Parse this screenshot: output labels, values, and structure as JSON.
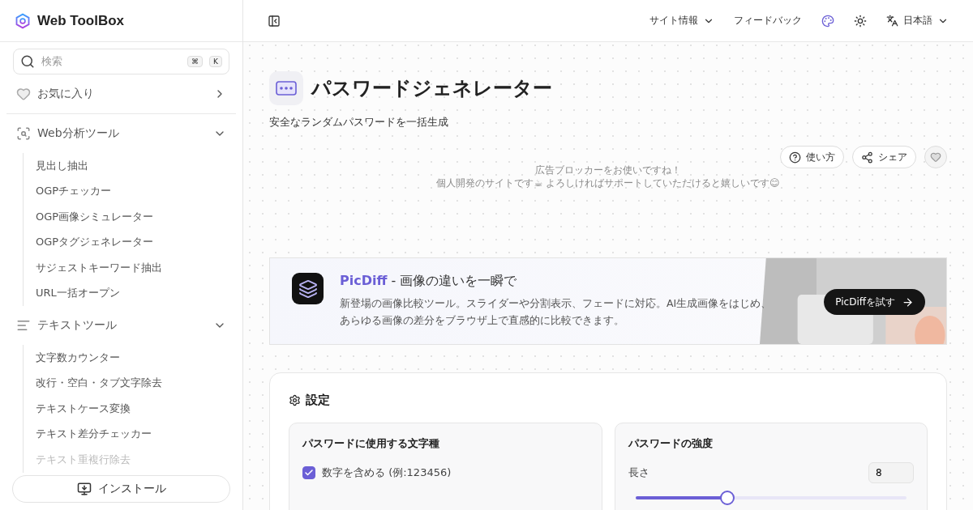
{
  "brand": {
    "name": "Web ToolBox"
  },
  "search": {
    "placeholder": "検索",
    "keys": [
      "⌘",
      "K"
    ]
  },
  "favorites": {
    "label": "お気に入り",
    "expanded": false
  },
  "sections": [
    {
      "label": "Web分析ツール",
      "expanded": true,
      "items": [
        "見出し抽出",
        "OGPチェッカー",
        "OGP画像シミュレーター",
        "OGPタグジェネレーター",
        "サジェストキーワード抽出",
        "URL一括オープン"
      ]
    },
    {
      "label": "テキストツール",
      "expanded": true,
      "items": [
        "文字数カウンター",
        "改行・空白・タブ文字除去",
        "テキストケース変換",
        "テキスト差分チェッカー",
        "テキスト重複行除去"
      ]
    }
  ],
  "install": {
    "label": "インストール"
  },
  "header": {
    "menus": [
      {
        "label": "サイト情報",
        "kind": "dropdown"
      },
      {
        "label": "フィードバック",
        "kind": "link"
      }
    ],
    "language": "日本語"
  },
  "page": {
    "title": "パスワードジェネレーター",
    "subtitle": "安全なランダムパスワードを一括生成",
    "actions": [
      {
        "label": "使い方",
        "kind": "help"
      },
      {
        "label": "シェア",
        "kind": "share"
      }
    ],
    "favorite": false
  },
  "notice": [
    "広告ブロッカーをお使いですね！",
    "個人開発のサイトです☕ よろしければサポートしていただけると嬉しいです😊"
  ],
  "promo": {
    "name": "PicDiff",
    "headline": " - 画像の違いを一瞬で",
    "description": "新登場の画像比較ツール。スライダーや分割表示、フェードに対応。AI生成画像をはじめ、あらゆる画像の差分をブラウザ上で直感的に比較できます。",
    "button": "PicDiffを試す"
  },
  "settings": {
    "title": "設定",
    "charset": {
      "title": "パスワードに使用する文字種",
      "options": [
        {
          "label": "数字を含める (例:123456)",
          "checked": true
        }
      ]
    },
    "strength": {
      "title": "パスワードの強度",
      "length_label": "長さ",
      "length": "8",
      "level": 0.34
    }
  }
}
